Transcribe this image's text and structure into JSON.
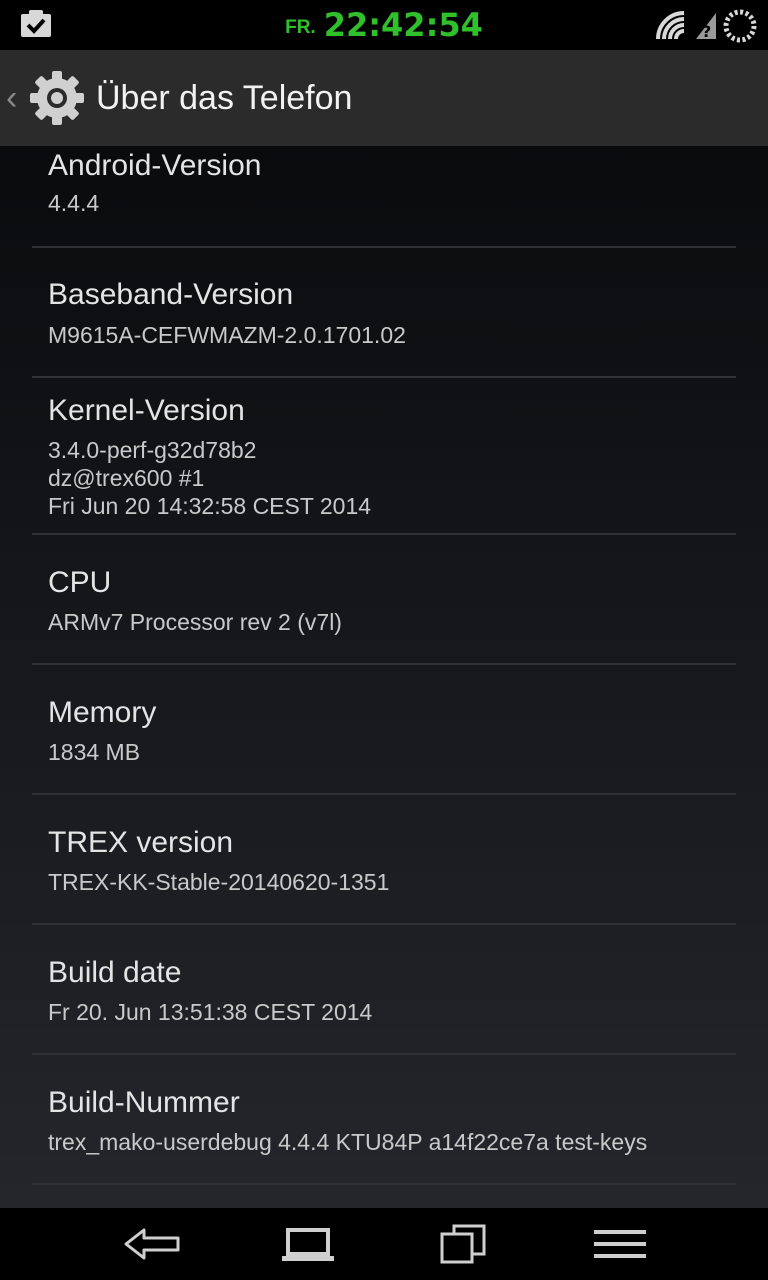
{
  "status_bar": {
    "day": "FR.",
    "time": "22:42:54",
    "clock_color": "#2fc02b",
    "left_icon": "clipboard-check-icon",
    "right_icons": [
      "wifi-icon",
      "signal-unknown-icon",
      "battery-circle-icon"
    ]
  },
  "action_bar": {
    "title": "Über das Telefon",
    "icon": "settings-gear-icon"
  },
  "items": [
    {
      "title": "Android-Version",
      "summary": [
        "4.4.4"
      ]
    },
    {
      "title": "Baseband-Version",
      "summary": [
        "M9615A-CEFWMAZM-2.0.1701.02"
      ]
    },
    {
      "title": "Kernel-Version",
      "summary": [
        "3.4.0-perf-g32d78b2",
        "dz@trex600 #1",
        "Fri Jun 20 14:32:58 CEST 2014"
      ]
    },
    {
      "title": "CPU",
      "summary": [
        "ARMv7 Processor rev 2 (v7l)"
      ]
    },
    {
      "title": "Memory",
      "summary": [
        "1834 MB"
      ]
    },
    {
      "title": "TREX version",
      "summary": [
        "TREX-KK-Stable-20140620-1351"
      ]
    },
    {
      "title": "Build date",
      "summary": [
        "Fr 20. Jun 13:51:38 CEST 2014"
      ]
    },
    {
      "title": "Build-Nummer",
      "summary": [
        "trex_mako-userdebug 4.4.4 KTU84P a14f22ce7a test-keys"
      ]
    }
  ],
  "nav_bar": {
    "buttons": [
      "back-icon",
      "home-icon",
      "recent-apps-icon",
      "menu-icon"
    ]
  }
}
